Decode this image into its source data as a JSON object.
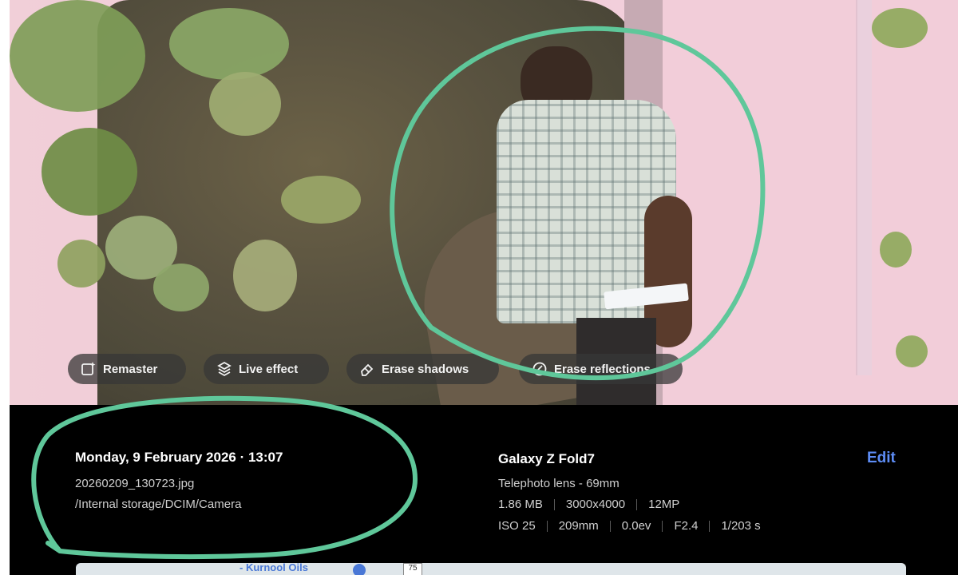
{
  "photo_actions": [
    {
      "label": "Remaster",
      "icon": "remaster-icon"
    },
    {
      "label": "Live effect",
      "icon": "live-effect-icon"
    },
    {
      "label": "Erase shadows",
      "icon": "eraser-icon"
    },
    {
      "label": "Erase reflections",
      "icon": "reflection-icon"
    }
  ],
  "details": {
    "datetime": "Monday, 9 February 2026 · 13:07",
    "filename": "20260209_130723.jpg",
    "path": "/Internal storage/DCIM/Camera",
    "device": "Galaxy Z Fold7",
    "lens": "Telephoto lens - 69mm",
    "file_info": [
      "1.86 MB",
      "3000x4000",
      "12MP"
    ],
    "exposure": [
      "ISO 25",
      "209mm",
      "0.0ev",
      "F2.4",
      "1/203 s"
    ],
    "edit_label": "Edit"
  },
  "map": {
    "place_label": "- Kurnool Oils",
    "road_number": "75"
  },
  "colors": {
    "annotation": "#5fc79a",
    "accent": "#5d8cf5",
    "panel": "#000000"
  }
}
